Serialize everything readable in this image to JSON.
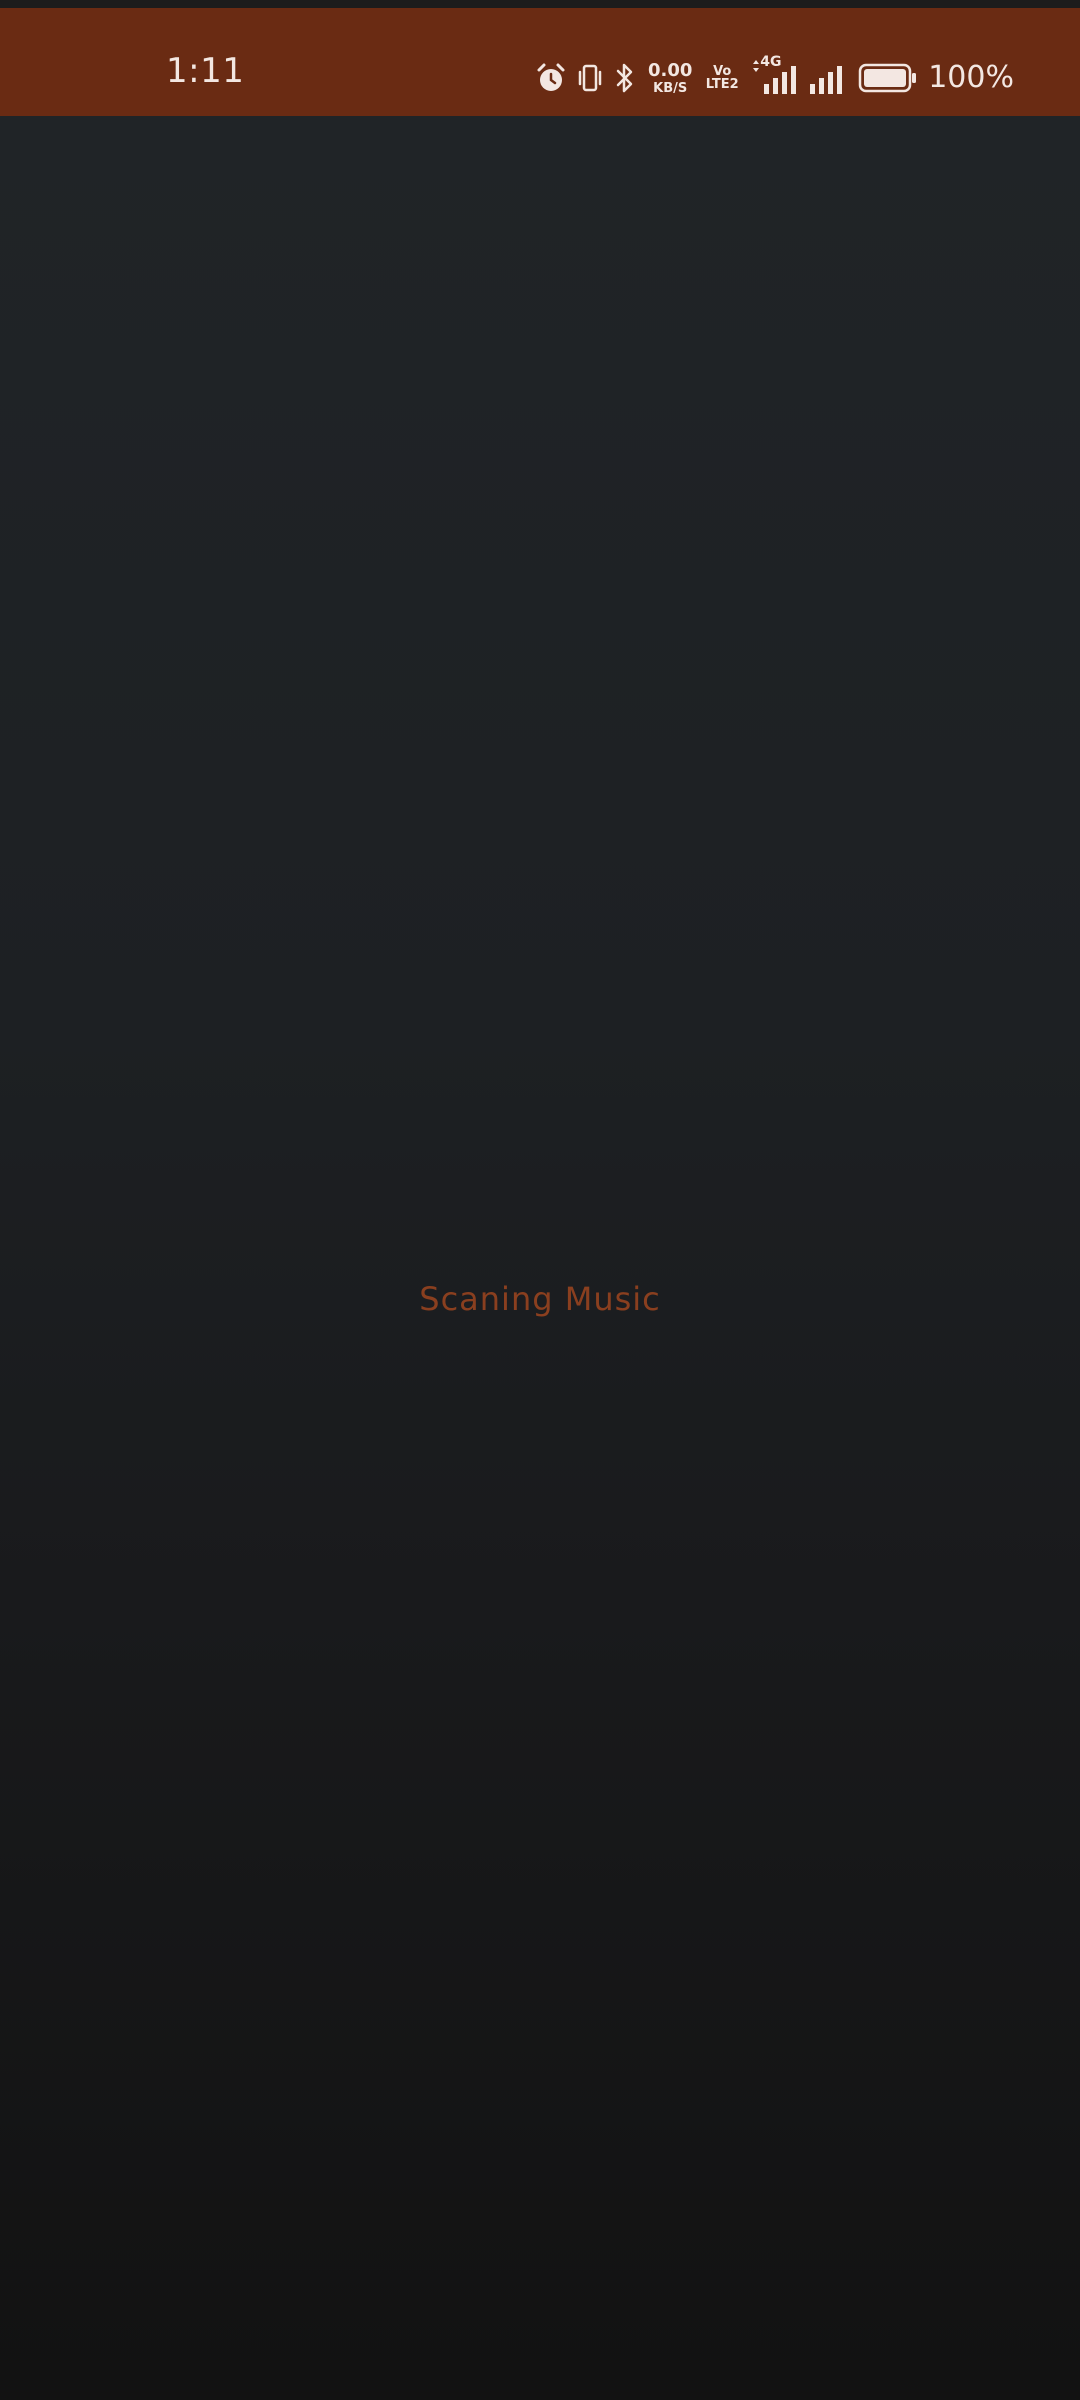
{
  "status_bar": {
    "time": "1:11",
    "net_speed_value": "0.00",
    "net_speed_unit": "KB/S",
    "volte_top": "Vo",
    "volte_bottom": "LTE2",
    "network_type": "4G",
    "battery_percent": "100%",
    "background_color": "#6a2b13",
    "icons": [
      "alarm-icon",
      "vibrate-icon",
      "bluetooth-icon",
      "signal-icon",
      "battery-icon"
    ]
  },
  "main": {
    "status_text": "Scaning Music",
    "status_text_color": "#8a3f1f"
  }
}
